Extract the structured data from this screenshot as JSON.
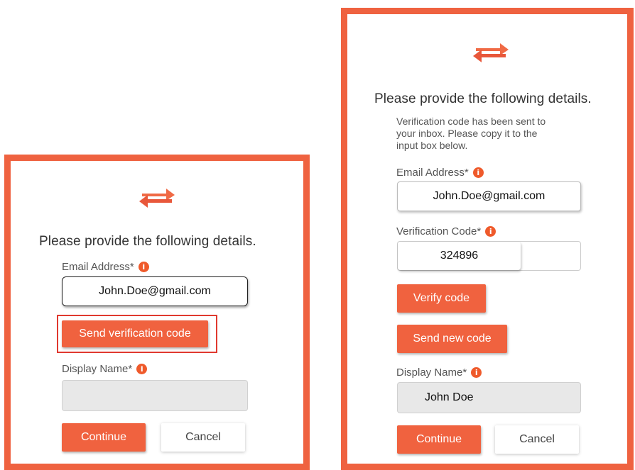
{
  "colors": {
    "accent": "#ef6240",
    "highlight": "#e0392f"
  },
  "left": {
    "heading": "Please provide the following details.",
    "email_label": "Email Address*",
    "email_value": "John.Doe@gmail.com",
    "send_code_label": "Send verification code",
    "display_name_label": "Display Name*",
    "display_name_value": "",
    "continue_label": "Continue",
    "cancel_label": "Cancel"
  },
  "right": {
    "heading": "Please provide the following details.",
    "message": "Verification code has been sent to\nyour inbox. Please copy it to the\ninput box below.",
    "email_label": "Email Address*",
    "email_value": "John.Doe@gmail.com",
    "code_label": "Verification Code*",
    "code_value": "324896",
    "verify_label": "Verify code",
    "send_new_label": "Send new code",
    "display_name_label": "Display Name*",
    "display_name_value": "John Doe",
    "continue_label": "Continue",
    "cancel_label": "Cancel"
  },
  "icons": {
    "logo": "exchange-arrows-icon",
    "info": "info-icon"
  }
}
